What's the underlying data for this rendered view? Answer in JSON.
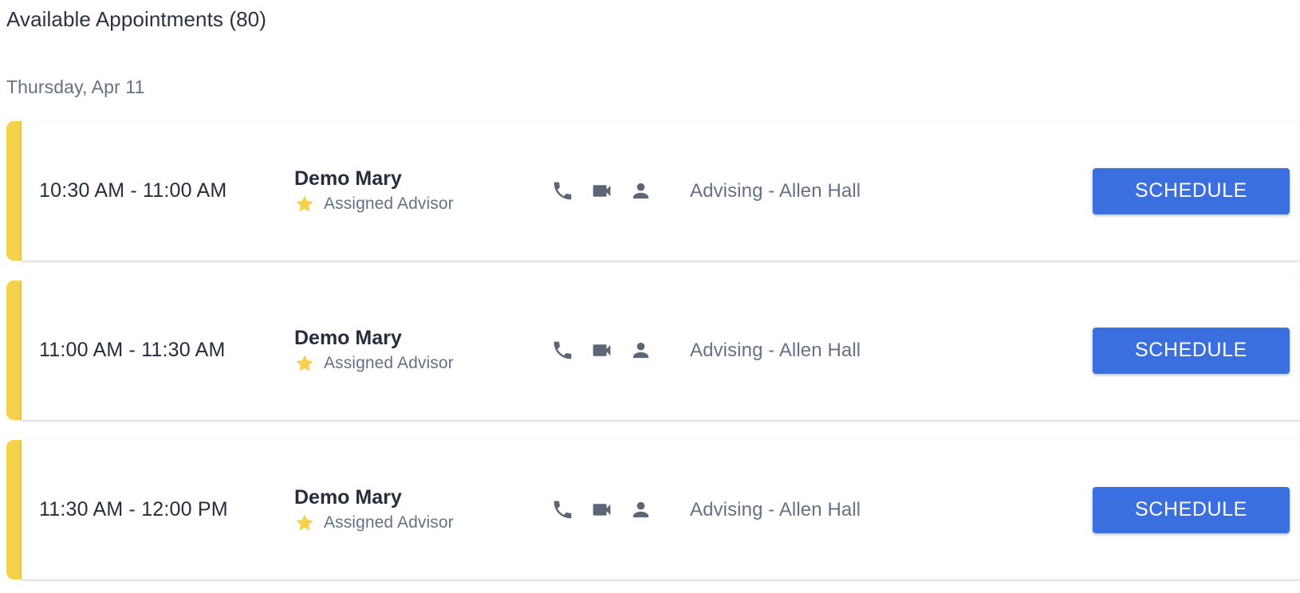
{
  "header": {
    "title": "Available Appointments (80)",
    "day_heading": "Thursday, Apr 11"
  },
  "colors": {
    "accent_bar": "#f6d14e",
    "schedule_button": "#3b6fe0",
    "title_text": "#2b3245",
    "muted_text": "#667186",
    "icon": "#5c6675",
    "star": "#f6d14e"
  },
  "appointments": [
    {
      "time": "10:30 AM - 11:00 AM",
      "advisor_name": "Demo Mary",
      "advisor_tag": "Assigned Advisor",
      "star_icon": "star-icon",
      "modes": [
        "phone-icon",
        "video-icon",
        "person-icon"
      ],
      "location": "Advising - Allen Hall",
      "action_label": "SCHEDULE"
    },
    {
      "time": "11:00 AM - 11:30 AM",
      "advisor_name": "Demo Mary",
      "advisor_tag": "Assigned Advisor",
      "star_icon": "star-icon",
      "modes": [
        "phone-icon",
        "video-icon",
        "person-icon"
      ],
      "location": "Advising - Allen Hall",
      "action_label": "SCHEDULE"
    },
    {
      "time": "11:30 AM - 12:00 PM",
      "advisor_name": "Demo Mary",
      "advisor_tag": "Assigned Advisor",
      "star_icon": "star-icon",
      "modes": [
        "phone-icon",
        "video-icon",
        "person-icon"
      ],
      "location": "Advising - Allen Hall",
      "action_label": "SCHEDULE"
    }
  ]
}
